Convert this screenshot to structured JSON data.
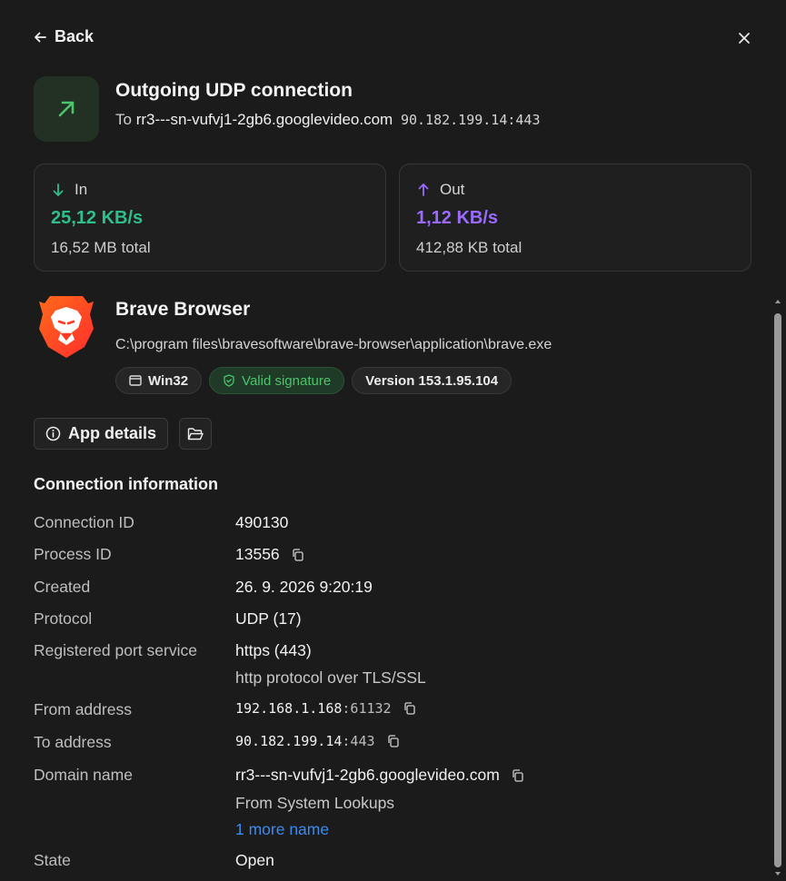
{
  "nav": {
    "back_label": "Back"
  },
  "header": {
    "title": "Outgoing UDP connection",
    "to_prefix": "To",
    "host": "rr3---sn-vufvj1-2gb6.googlevideo.com",
    "address": "90.182.199.14:443"
  },
  "traffic": {
    "in": {
      "label": "In",
      "rate": "25,12 KB/s",
      "total": "16,52 MB total",
      "color": "#2fbf8a"
    },
    "out": {
      "label": "Out",
      "rate": "1,12 KB/s",
      "total": "412,88 KB total",
      "color": "#9a6bff"
    }
  },
  "app": {
    "name": "Brave Browser",
    "path": "C:\\program files\\bravesoftware\\brave-browser\\application\\brave.exe",
    "badges": {
      "platform": "Win32",
      "signature": "Valid signature",
      "version": "Version 153.1.95.104"
    }
  },
  "actions": {
    "app_details_label": "App details"
  },
  "connection": {
    "section_title": "Connection information",
    "connection_id": {
      "label": "Connection ID",
      "value": "490130"
    },
    "process_id": {
      "label": "Process ID",
      "value": "13556"
    },
    "created": {
      "label": "Created",
      "value": "26. 9. 2026 9:20:19"
    },
    "protocol": {
      "label": "Protocol",
      "value": "UDP (17)"
    },
    "port_service": {
      "label": "Registered port service",
      "value": "https (443)",
      "description": "http protocol over TLS/SSL"
    },
    "from_address": {
      "label": "From address",
      "ip": "192.168.1.168",
      "port": ":61132"
    },
    "to_address": {
      "label": "To address",
      "ip": "90.182.199.14",
      "port": ":443"
    },
    "domain": {
      "label": "Domain name",
      "value": "rr3---sn-vufvj1-2gb6.googlevideo.com",
      "source": "From System Lookups",
      "more_link": "1 more name"
    },
    "state": {
      "label": "State",
      "value": "Open"
    }
  },
  "icons": {
    "back": "arrow-left-icon",
    "close": "close-icon",
    "direction": "arrow-up-right-icon",
    "in": "arrow-down-icon",
    "out": "arrow-up-icon",
    "window": "window-icon",
    "shield": "shield-check-icon",
    "info": "info-icon",
    "folder": "folder-open-icon",
    "copy": "copy-icon"
  }
}
